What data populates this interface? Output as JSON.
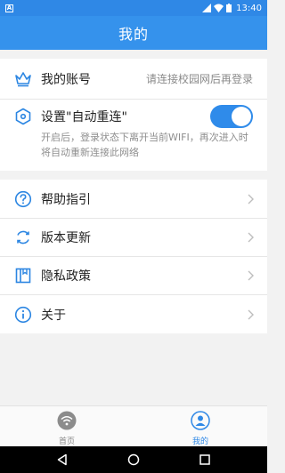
{
  "status_bar": {
    "notification": "A",
    "time": "13:40"
  },
  "header": {
    "title": "我的"
  },
  "account": {
    "label": "我的账号",
    "value": "请连接校园网后再登录"
  },
  "auto_reconnect": {
    "label": "设置\"自动重连\"",
    "enabled": true,
    "description": "开启后，登录状态下离开当前WIFI，再次进入时将自动重新连接此网络"
  },
  "menu": {
    "items": [
      {
        "label": "帮助指引"
      },
      {
        "label": "版本更新"
      },
      {
        "label": "隐私政策"
      },
      {
        "label": "关于"
      }
    ]
  },
  "tabbar": {
    "tabs": [
      {
        "label": "首页",
        "active": false
      },
      {
        "label": "我的",
        "active": true
      }
    ]
  },
  "colors": {
    "primary": "#2f88e6",
    "app_bar": "#3592ec",
    "icon": "#2c86e2",
    "text": "#222222",
    "muted": "#8a8a8a"
  },
  "icons": [
    "crown-icon",
    "hexagon-settings-icon",
    "question-icon",
    "refresh-icon",
    "book-icon",
    "info-icon",
    "chevron-right-icon",
    "wifi-icon",
    "user-icon"
  ]
}
